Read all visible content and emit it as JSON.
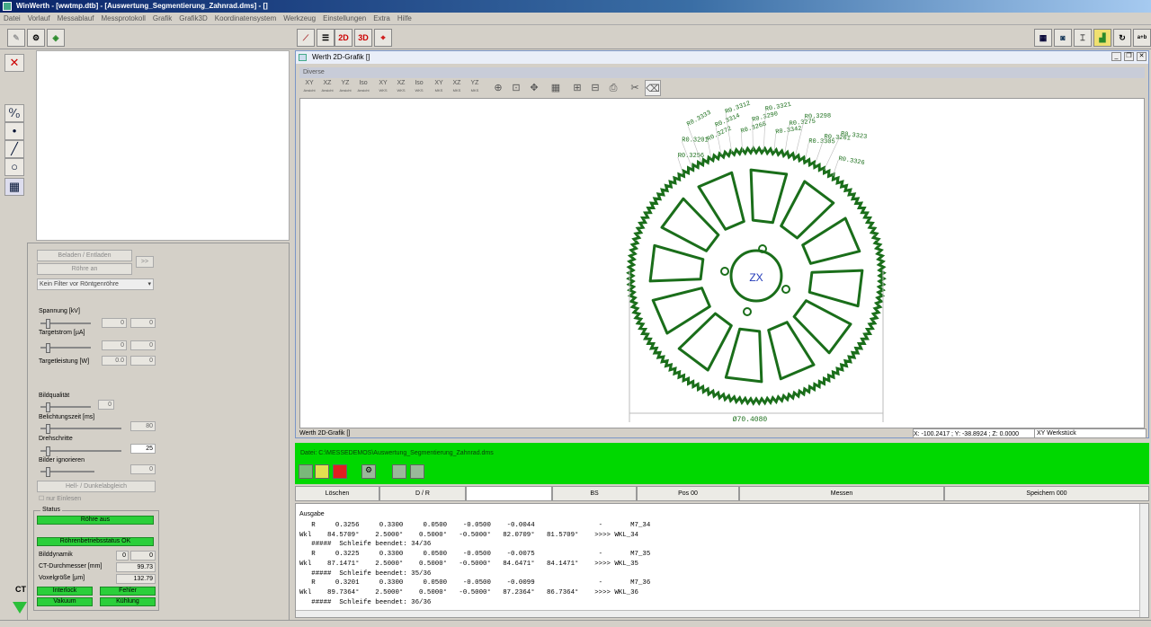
{
  "window": {
    "title": "WinWerth - [wwtmp.dtb] - [Auswertung_Segmentierung_Zahnrad.dms] - []"
  },
  "menu": [
    "Datei",
    "Vorlauf",
    "Messablauf",
    "Messprotokoll",
    "Grafik",
    "Grafik3D",
    "Koordinatensystem",
    "Werkzeug",
    "Einstellungen",
    "Extra",
    "Hilfe"
  ],
  "toolbar": {
    "btn_2d": "2D",
    "btn_3d": "3D"
  },
  "left": {
    "laden_btn": "Beladen / Entladen",
    "roehre_btn": "Röhre an",
    "arrow_btn": ">>",
    "filter_select": "Kein Filter vor Röntgenröhre",
    "spannung_label": "Spannung [kV]",
    "spannung_val": "0",
    "spannung_val2": "0",
    "targetstrom_label": "Targetstrom [µA]",
    "targetstrom_val": "0",
    "targetstrom_val2": "0",
    "targetleistung_label": "Targetleistung [W]",
    "targetleistung_val": "0.0",
    "targetleistung_val2": "0",
    "bildqualitaet_label": "Bildqualität",
    "bildqualitaet_val": "0",
    "belichtung_label": "Belichtungszeit [ms]",
    "belichtung_val": "80",
    "drehschritte_label": "Drehschritte",
    "drehschritte_val": "25",
    "bilder_label": "Bilder ignorieren",
    "bilder_val": "0",
    "hell_btn": "Hell- / Dunkelabgleich",
    "einlesen_label": "nur Einlesen",
    "status_title": "Status",
    "roehre_aus": "Röhre aus",
    "betrieb": "Röhrenbetriebsstatus OK",
    "bilddynamik_label": "Bilddynamik",
    "bilddynamik_val": "0",
    "bilddynamik_val2": "0",
    "ct_durch_label": "CT-Durchmesser [mm]",
    "ct_durch_val": "99.73",
    "voxel_label": "Voxelgröße [µm]",
    "voxel_val": "132.79",
    "interlock": "Interlock",
    "fehler": "Fehler",
    "vakuum": "Vakuum",
    "kuehlung": "Kühlung",
    "ct_label": "CT"
  },
  "grafik": {
    "title": "Werth 2D-Grafik []",
    "diverse": "Diverse",
    "view_buttons": [
      {
        "top": "XY",
        "sub": "Ansicht"
      },
      {
        "top": "XZ",
        "sub": "Ansicht"
      },
      {
        "top": "YZ",
        "sub": "Ansicht"
      },
      {
        "top": "Iso",
        "sub": "Ansicht"
      },
      {
        "top": "XY",
        "sub": "WKS"
      },
      {
        "top": "XZ",
        "sub": "WKS"
      },
      {
        "top": "Iso",
        "sub": "WKS"
      },
      {
        "top": "XY",
        "sub": "MKS"
      },
      {
        "top": "XZ",
        "sub": "MKS"
      },
      {
        "top": "YZ",
        "sub": "MKS"
      }
    ],
    "dim_label": "Ø70.4080",
    "center_label": "ZX",
    "radius_labels": [
      "R0.3256",
      "R0.3201",
      "R0.3333",
      "R0.3272",
      "R0.3314",
      "R0.3312",
      "R0.3268",
      "R0.3290",
      "R0.3321",
      "R0.3342",
      "R0.3275",
      "R0.3298",
      "R0.3305",
      "R0.3261",
      "R0.3323",
      "R0.3326"
    ],
    "footer": "Werth 2D-Grafik []",
    "coords": "X: -100.2417 ; Y: -38.8924 ; Z:   0.0000",
    "coord_system": "XY Werkstück"
  },
  "messung": {
    "datei": "Datei:    C:\\MESSEDEMOS\\Auswertung_Segmentierung_Zahnrad.dms",
    "buttons": [
      "Löschen",
      "D / R",
      "",
      "BS",
      "Pos 00",
      "Messen",
      "Speichern 000"
    ]
  },
  "ausgabe": {
    "label": "Ausgabe",
    "lines": [
      "   R     0.3256     0.3300     0.0500    -0.0500    -0.0044                -       M7_34",
      "Wkl    84.5709°    2.5000°    0.5000°   -0.5000°   82.0709°   81.5709°    >>>> WKL_34",
      "   #####  Schleife beendet: 34/36",
      "   R     0.3225     0.3300     0.0500    -0.0500    -0.0075                -       M7_35",
      "Wkl    87.1471°    2.5000°    0.5000°   -0.5000°   84.6471°   84.1471°    >>>> WKL_35",
      "   #####  Schleife beendet: 35/36",
      "   R     0.3201     0.3300     0.0500    -0.0500    -0.0099                -       M7_36",
      "Wkl    89.7364°    2.5000°    0.5000°   -0.5000°   87.2364°   86.7364°    >>>> WKL_36",
      "   #####  Schleife beendet: 36/36"
    ]
  },
  "colors": {
    "green": "#00d800",
    "drawing": "#1a6e1a"
  }
}
